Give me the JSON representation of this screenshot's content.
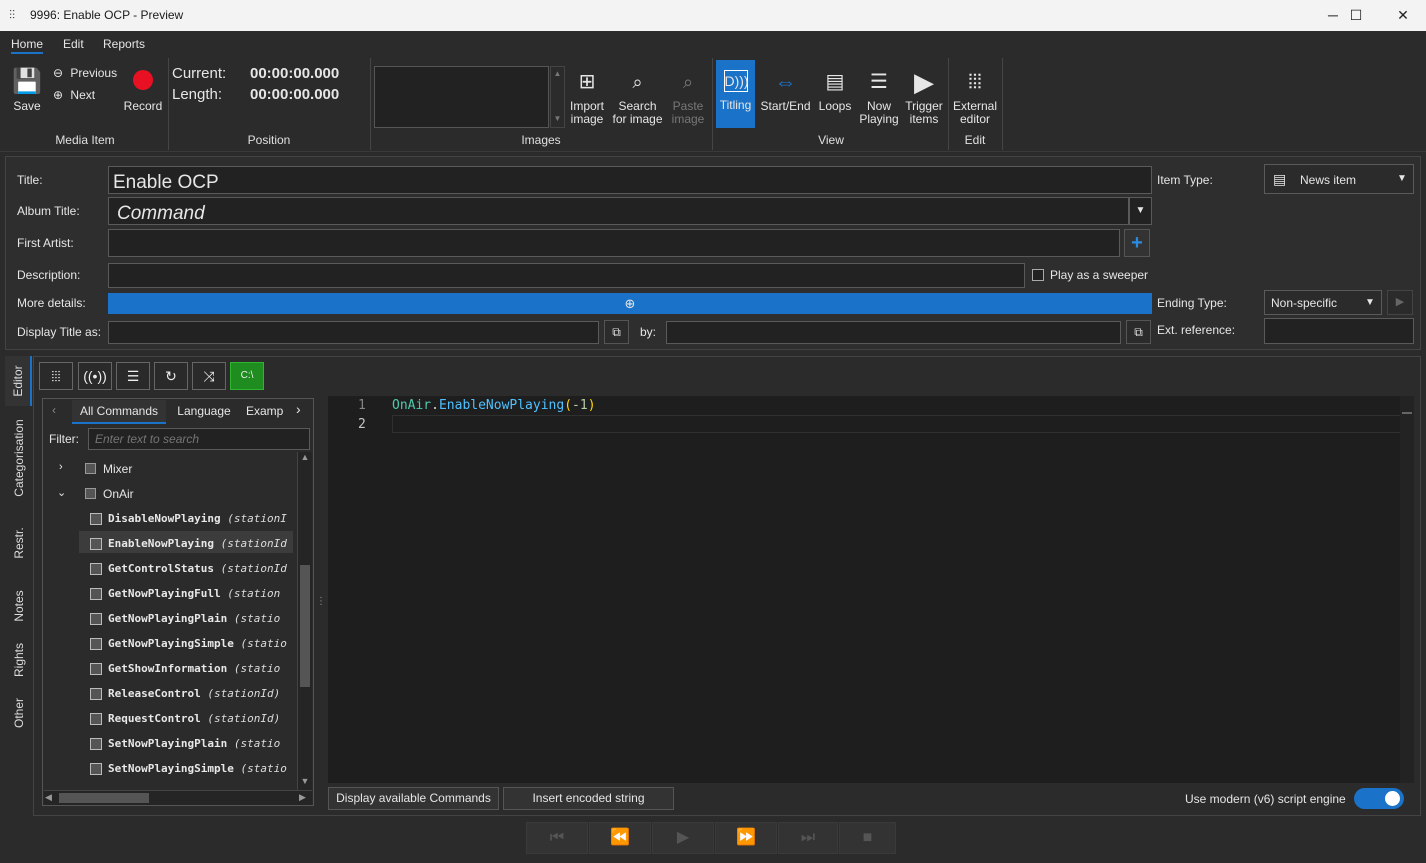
{
  "window": {
    "title": "9996: Enable OCP  - Preview",
    "icon": "waveform-icon",
    "minimize": "─",
    "maximize": "☐",
    "close": "✕"
  },
  "menu": {
    "items": [
      "Home",
      "Edit",
      "Reports"
    ]
  },
  "ribbon": {
    "media_item": {
      "save": "Save",
      "previous": "Previous",
      "next": "Next",
      "record": "Record",
      "group": "Media Item"
    },
    "position": {
      "current_label": "Current:",
      "current_value": "00:00:00.000",
      "length_label": "Length:",
      "length_value": "00:00:00.000",
      "group": "Position"
    },
    "images": {
      "import": "Import image",
      "search": "Search for image",
      "paste": "Paste image",
      "group": "Images"
    },
    "view": {
      "titling": "Titling",
      "start_end": "Start/End",
      "loops": "Loops",
      "now_playing": "Now Playing",
      "trigger": "Trigger items",
      "group": "View"
    },
    "edit": {
      "external": "External editor",
      "group": "Edit"
    }
  },
  "form": {
    "title_label": "Title:",
    "title_value": "Enable OCP",
    "album_label": "Album Title:",
    "album_value": "Command",
    "artist_label": "First Artist:",
    "artist_value": "",
    "description_label": "Description:",
    "description_value": "",
    "sweeper_label": "Play as a sweeper",
    "sweeper_checked": false,
    "more_details_label": "More details:",
    "display_title_label": "Display Title as:",
    "by_label": "by:",
    "item_type_label": "Item Type:",
    "item_type_value": "News item",
    "ending_type_label": "Ending Type:",
    "ending_type_value": "Non-specific",
    "ext_ref_label": "Ext. reference:",
    "ext_ref_value": ""
  },
  "sidetabs": [
    "Editor",
    "Categorisation",
    "Restr.",
    "Notes",
    "Rights",
    "Other"
  ],
  "commands": {
    "tabs": [
      "All Commands",
      "Language",
      "Examp"
    ],
    "filter_label": "Filter:",
    "filter_placeholder": "Enter text to search",
    "groups": [
      {
        "name": "Mixer",
        "expanded": false
      },
      {
        "name": "OnAir",
        "expanded": true
      }
    ],
    "items": [
      {
        "name": "DisableNowPlaying",
        "args": "(stationI"
      },
      {
        "name": "EnableNowPlaying",
        "args": "(stationId"
      },
      {
        "name": "GetControlStatus",
        "args": "(stationId"
      },
      {
        "name": "GetNowPlayingFull",
        "args": "(station"
      },
      {
        "name": "GetNowPlayingPlain",
        "args": "(statio"
      },
      {
        "name": "GetNowPlayingSimple",
        "args": "(statio"
      },
      {
        "name": "GetShowInformation",
        "args": "(statio"
      },
      {
        "name": "ReleaseControl",
        "args": "(stationId)"
      },
      {
        "name": "RequestControl",
        "args": "(stationId)"
      },
      {
        "name": "SetNowPlayingPlain",
        "args": "(statio"
      },
      {
        "name": "SetNowPlayingSimple",
        "args": "(statio"
      }
    ],
    "selected": "EnableNowPlaying"
  },
  "editor": {
    "lines": [
      {
        "n": "1",
        "obj": "OnAir",
        "method": "EnableNowPlaying",
        "arg": "-1"
      },
      {
        "n": "2"
      }
    ]
  },
  "bottom": {
    "display_btn": "Display available Commands",
    "insert_btn": "Insert encoded string",
    "engine_label": "Use modern (v6) script engine",
    "engine_on": true
  },
  "colors": {
    "accent": "#1a73c8",
    "record": "#e81123",
    "script_icon": "#1e8c1e"
  }
}
